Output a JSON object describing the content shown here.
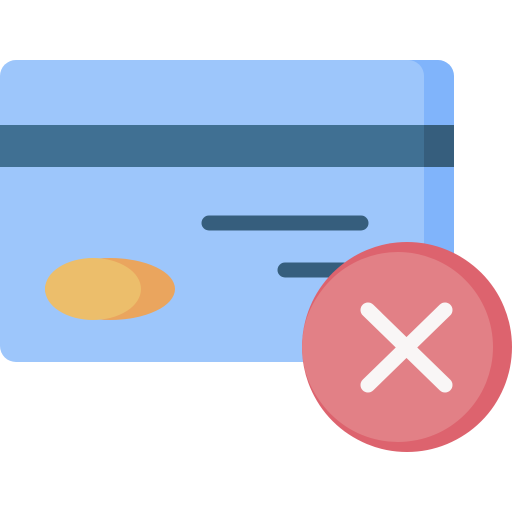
{
  "icon": {
    "name": "credit-card-declined-icon",
    "parts": [
      "credit-card-icon",
      "cancel-x-icon"
    ]
  },
  "colors": {
    "card_body": "#9dc6fb",
    "card_side": "#80b4fb",
    "stripe": "#407093",
    "stripe_dark": "#365e7d",
    "text_lines": "#365e7d",
    "chip_left": "#ecbe6b",
    "chip_right": "#eaa55e",
    "badge": "#e28086",
    "badge_shade": "#dd636e",
    "x_mark": "#f9f6f6"
  }
}
